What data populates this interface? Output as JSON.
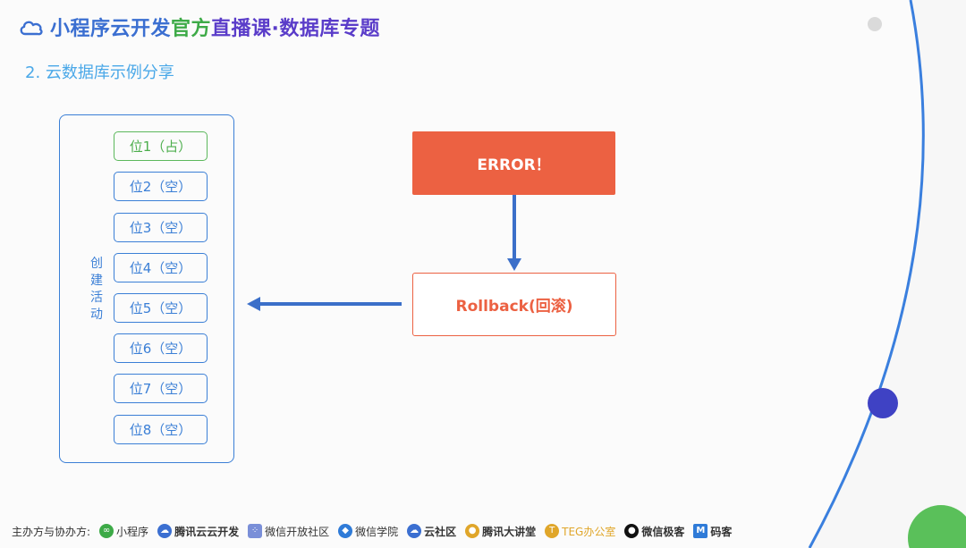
{
  "header": {
    "title_part1": "小程序云开发",
    "title_part2": "官方",
    "title_part3": "直播课·数据库专题",
    "colors": {
      "part1": "#3b6fd1",
      "part2": "#3daa47",
      "part3": "#5a3cc9"
    }
  },
  "subtitle": "2. 云数据库示例分享",
  "activity": {
    "label_chars": [
      "创",
      "建",
      "活",
      "动"
    ],
    "slots": [
      {
        "label": "位1（占）",
        "state": "occupied"
      },
      {
        "label": "位2（空）",
        "state": "empty"
      },
      {
        "label": "位3（空）",
        "state": "empty"
      },
      {
        "label": "位4（空）",
        "state": "empty"
      },
      {
        "label": "位5（空）",
        "state": "empty"
      },
      {
        "label": "位6（空）",
        "state": "empty"
      },
      {
        "label": "位7（空）",
        "state": "empty"
      },
      {
        "label": "位8（空）",
        "state": "empty"
      }
    ]
  },
  "flow": {
    "error_label": "ERROR！",
    "rollback_label": "Rollback(回滚)",
    "colors": {
      "error": "#ec6142",
      "arrow": "#3b6fc9"
    }
  },
  "footer": {
    "prefix": "主办方与协办方:",
    "sponsors": [
      {
        "name": "小程序",
        "icon": "miniprogram-icon"
      },
      {
        "name": "腾讯云云开发",
        "icon": "cloud-icon"
      },
      {
        "name": "微信开放社区",
        "icon": "dots-icon"
      },
      {
        "name": "微信学院",
        "icon": "diamond-icon"
      },
      {
        "name": "云社区",
        "icon": "cloud-community-icon"
      },
      {
        "name": "腾讯大讲堂",
        "icon": "lecture-icon"
      },
      {
        "name": "TEG办公室",
        "icon": "teg-icon"
      },
      {
        "name": "微信极客",
        "icon": "geek-icon"
      },
      {
        "name": "码客",
        "icon": "mk-icon"
      }
    ]
  }
}
